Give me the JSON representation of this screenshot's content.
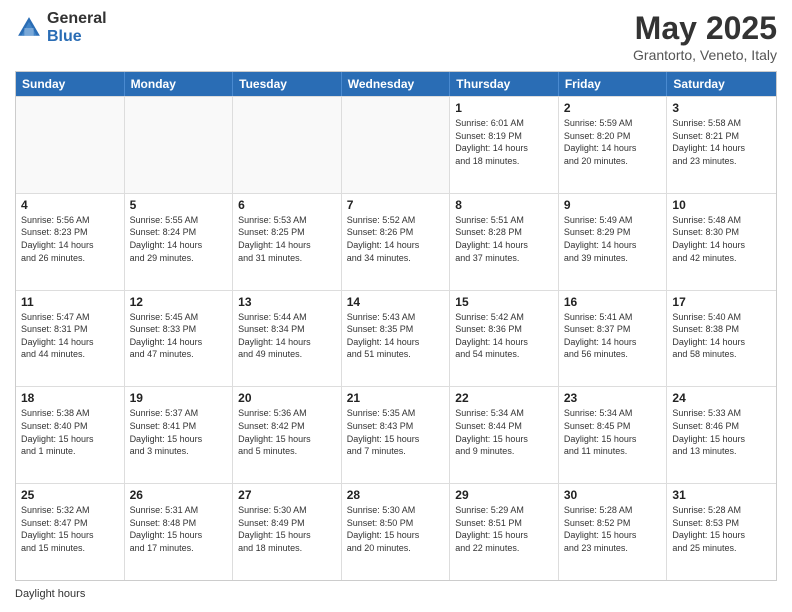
{
  "logo": {
    "general": "General",
    "blue": "Blue"
  },
  "title": {
    "month": "May 2025",
    "location": "Grantorto, Veneto, Italy"
  },
  "calendar": {
    "headers": [
      "Sunday",
      "Monday",
      "Tuesday",
      "Wednesday",
      "Thursday",
      "Friday",
      "Saturday"
    ],
    "rows": [
      [
        {
          "day": "",
          "info": ""
        },
        {
          "day": "",
          "info": ""
        },
        {
          "day": "",
          "info": ""
        },
        {
          "day": "",
          "info": ""
        },
        {
          "day": "1",
          "info": "Sunrise: 6:01 AM\nSunset: 8:19 PM\nDaylight: 14 hours\nand 18 minutes."
        },
        {
          "day": "2",
          "info": "Sunrise: 5:59 AM\nSunset: 8:20 PM\nDaylight: 14 hours\nand 20 minutes."
        },
        {
          "day": "3",
          "info": "Sunrise: 5:58 AM\nSunset: 8:21 PM\nDaylight: 14 hours\nand 23 minutes."
        }
      ],
      [
        {
          "day": "4",
          "info": "Sunrise: 5:56 AM\nSunset: 8:23 PM\nDaylight: 14 hours\nand 26 minutes."
        },
        {
          "day": "5",
          "info": "Sunrise: 5:55 AM\nSunset: 8:24 PM\nDaylight: 14 hours\nand 29 minutes."
        },
        {
          "day": "6",
          "info": "Sunrise: 5:53 AM\nSunset: 8:25 PM\nDaylight: 14 hours\nand 31 minutes."
        },
        {
          "day": "7",
          "info": "Sunrise: 5:52 AM\nSunset: 8:26 PM\nDaylight: 14 hours\nand 34 minutes."
        },
        {
          "day": "8",
          "info": "Sunrise: 5:51 AM\nSunset: 8:28 PM\nDaylight: 14 hours\nand 37 minutes."
        },
        {
          "day": "9",
          "info": "Sunrise: 5:49 AM\nSunset: 8:29 PM\nDaylight: 14 hours\nand 39 minutes."
        },
        {
          "day": "10",
          "info": "Sunrise: 5:48 AM\nSunset: 8:30 PM\nDaylight: 14 hours\nand 42 minutes."
        }
      ],
      [
        {
          "day": "11",
          "info": "Sunrise: 5:47 AM\nSunset: 8:31 PM\nDaylight: 14 hours\nand 44 minutes."
        },
        {
          "day": "12",
          "info": "Sunrise: 5:45 AM\nSunset: 8:33 PM\nDaylight: 14 hours\nand 47 minutes."
        },
        {
          "day": "13",
          "info": "Sunrise: 5:44 AM\nSunset: 8:34 PM\nDaylight: 14 hours\nand 49 minutes."
        },
        {
          "day": "14",
          "info": "Sunrise: 5:43 AM\nSunset: 8:35 PM\nDaylight: 14 hours\nand 51 minutes."
        },
        {
          "day": "15",
          "info": "Sunrise: 5:42 AM\nSunset: 8:36 PM\nDaylight: 14 hours\nand 54 minutes."
        },
        {
          "day": "16",
          "info": "Sunrise: 5:41 AM\nSunset: 8:37 PM\nDaylight: 14 hours\nand 56 minutes."
        },
        {
          "day": "17",
          "info": "Sunrise: 5:40 AM\nSunset: 8:38 PM\nDaylight: 14 hours\nand 58 minutes."
        }
      ],
      [
        {
          "day": "18",
          "info": "Sunrise: 5:38 AM\nSunset: 8:40 PM\nDaylight: 15 hours\nand 1 minute."
        },
        {
          "day": "19",
          "info": "Sunrise: 5:37 AM\nSunset: 8:41 PM\nDaylight: 15 hours\nand 3 minutes."
        },
        {
          "day": "20",
          "info": "Sunrise: 5:36 AM\nSunset: 8:42 PM\nDaylight: 15 hours\nand 5 minutes."
        },
        {
          "day": "21",
          "info": "Sunrise: 5:35 AM\nSunset: 8:43 PM\nDaylight: 15 hours\nand 7 minutes."
        },
        {
          "day": "22",
          "info": "Sunrise: 5:34 AM\nSunset: 8:44 PM\nDaylight: 15 hours\nand 9 minutes."
        },
        {
          "day": "23",
          "info": "Sunrise: 5:34 AM\nSunset: 8:45 PM\nDaylight: 15 hours\nand 11 minutes."
        },
        {
          "day": "24",
          "info": "Sunrise: 5:33 AM\nSunset: 8:46 PM\nDaylight: 15 hours\nand 13 minutes."
        }
      ],
      [
        {
          "day": "25",
          "info": "Sunrise: 5:32 AM\nSunset: 8:47 PM\nDaylight: 15 hours\nand 15 minutes."
        },
        {
          "day": "26",
          "info": "Sunrise: 5:31 AM\nSunset: 8:48 PM\nDaylight: 15 hours\nand 17 minutes."
        },
        {
          "day": "27",
          "info": "Sunrise: 5:30 AM\nSunset: 8:49 PM\nDaylight: 15 hours\nand 18 minutes."
        },
        {
          "day": "28",
          "info": "Sunrise: 5:30 AM\nSunset: 8:50 PM\nDaylight: 15 hours\nand 20 minutes."
        },
        {
          "day": "29",
          "info": "Sunrise: 5:29 AM\nSunset: 8:51 PM\nDaylight: 15 hours\nand 22 minutes."
        },
        {
          "day": "30",
          "info": "Sunrise: 5:28 AM\nSunset: 8:52 PM\nDaylight: 15 hours\nand 23 minutes."
        },
        {
          "day": "31",
          "info": "Sunrise: 5:28 AM\nSunset: 8:53 PM\nDaylight: 15 hours\nand 25 minutes."
        }
      ]
    ]
  },
  "footer": {
    "daylight_note": "Daylight hours"
  }
}
